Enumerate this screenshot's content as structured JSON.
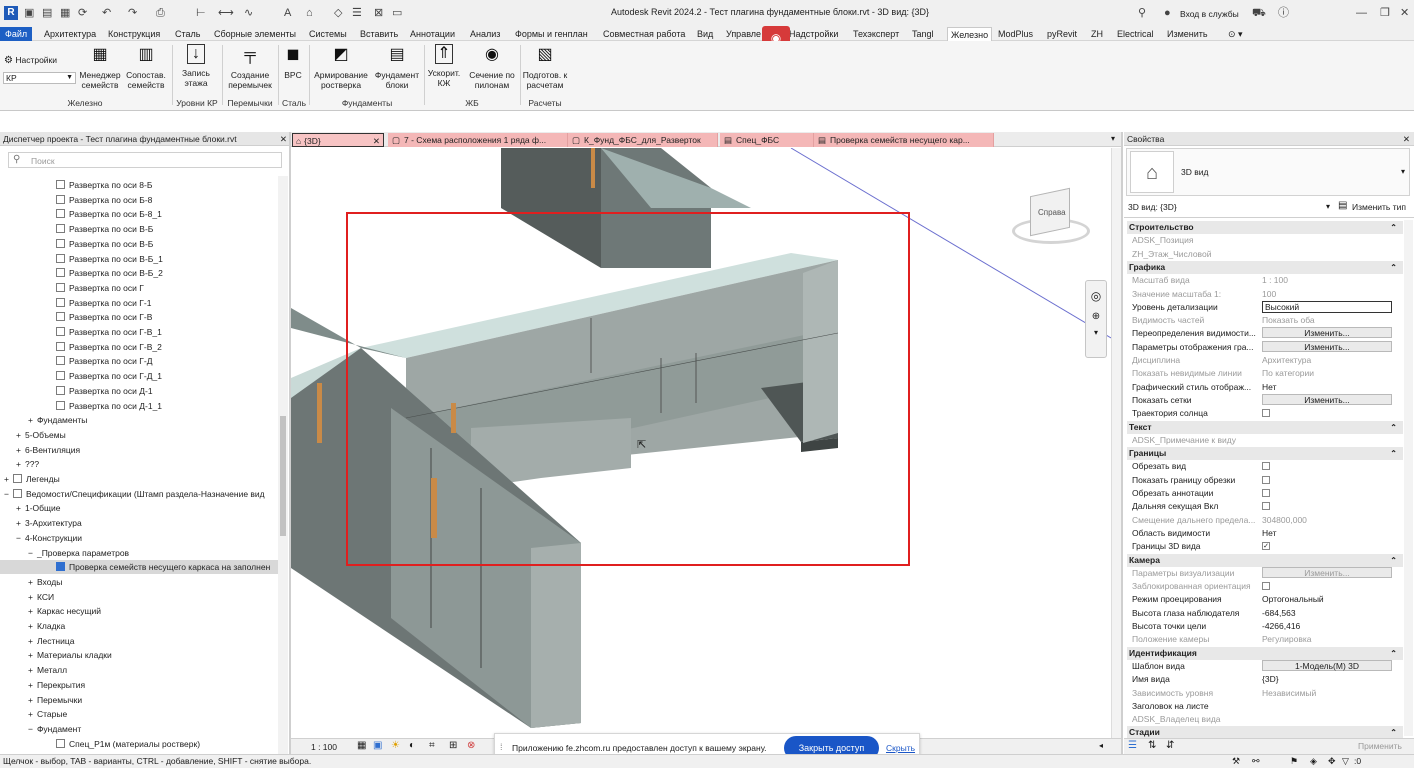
{
  "title_bar": {
    "title": "Autodesk Revit 2024.2 - Тест плагина фундаментные блоки.rvt - 3D вид: {3D}",
    "signin": "Вход в службы"
  },
  "menu": {
    "items": [
      "Файл",
      "Архитектура",
      "Конструкция",
      "Сталь",
      "Сборные элементы",
      "Системы",
      "Вставить",
      "Аннотации",
      "Анализ",
      "Формы и генплан",
      "Совместная работа",
      "Вид",
      "Управле",
      "Надстройки",
      "Техэксперт",
      "Tangl",
      "Железно",
      "ModPlus",
      "pyRevit",
      "ZH",
      "Electrical",
      "Изменить"
    ]
  },
  "ribbon": {
    "settings": "Настройки",
    "kr_select": "КР",
    "buttons": [
      {
        "label": "Менеджер семейств",
        "icon": "building-icon"
      },
      {
        "label": "Сопостав. семейств",
        "icon": "building-compare-icon"
      },
      {
        "label": "Запись этажа",
        "icon": "level-write-icon"
      },
      {
        "label": "Создание перемычек",
        "icon": "lintel-icon"
      },
      {
        "label": "BPC",
        "icon": "bps-icon"
      },
      {
        "label": "Армирование ростверка",
        "icon": "grillage-icon"
      },
      {
        "label": "Фундамент блоки",
        "icon": "blocks-icon"
      },
      {
        "label": "Ускорит. КЖ",
        "icon": "speed-icon"
      },
      {
        "label": "Сечение по пилонам",
        "icon": "eye-icon"
      },
      {
        "label": "Подготов. к расчетам",
        "icon": "calc-icon"
      }
    ],
    "groups": [
      "Железно",
      "Уровни КР",
      "Перемычки",
      "Сталь",
      "Фундаменты",
      "ЖБ",
      "Расчеты"
    ]
  },
  "project_browser": {
    "title": "Диспетчер проекта - Тест плагина фундаментные блоки.rvt",
    "search_placeholder": "Поиск",
    "items": [
      {
        "label": "Развертка по оси 8-Б",
        "level": 3,
        "box": true
      },
      {
        "label": "Развертка по оси Б-8",
        "level": 3,
        "box": true
      },
      {
        "label": "Развертка по оси Б-8_1",
        "level": 3,
        "box": true
      },
      {
        "label": "Развертка по оси В-Б",
        "level": 3,
        "box": true
      },
      {
        "label": "Развертка по оси В-Б",
        "level": 3,
        "box": true
      },
      {
        "label": "Развертка по оси В-Б_1",
        "level": 3,
        "box": true
      },
      {
        "label": "Развертка по оси В-Б_2",
        "level": 3,
        "box": true
      },
      {
        "label": "Развертка по оси Г",
        "level": 3,
        "box": true
      },
      {
        "label": "Развертка по оси Г-1",
        "level": 3,
        "box": true
      },
      {
        "label": "Развертка по оси Г-В",
        "level": 3,
        "box": true
      },
      {
        "label": "Развертка по оси Г-В_1",
        "level": 3,
        "box": true
      },
      {
        "label": "Развертка по оси Г-В_2",
        "level": 3,
        "box": true
      },
      {
        "label": "Развертка по оси Г-Д",
        "level": 3,
        "box": true
      },
      {
        "label": "Развертка по оси Г-Д_1",
        "level": 3,
        "box": true
      },
      {
        "label": "Развертка по оси Д-1",
        "level": 3,
        "box": true
      },
      {
        "label": "Развертка по оси Д-1_1",
        "level": 3,
        "box": true
      },
      {
        "label": "Фундаменты",
        "level": 2,
        "exp": "+"
      },
      {
        "label": "5-Объемы",
        "level": 1,
        "exp": "+"
      },
      {
        "label": "6-Вентиляция",
        "level": 1,
        "exp": "+"
      },
      {
        "label": "???",
        "level": 1,
        "exp": "+"
      },
      {
        "label": "Легенды",
        "level": 0,
        "exp": "+",
        "icon": true
      },
      {
        "label": "Ведомости/Спецификации (Штамп раздела-Назначение вид",
        "level": 0,
        "exp": "−",
        "icon": true
      },
      {
        "label": "1-Общие",
        "level": 1,
        "exp": "+"
      },
      {
        "label": "3-Архитектура",
        "level": 1,
        "exp": "+"
      },
      {
        "label": "4-Конструкции",
        "level": 1,
        "exp": "−"
      },
      {
        "label": "_Проверка параметров",
        "level": 2,
        "exp": "−"
      },
      {
        "label": "Проверка семейств несущего каркаса на заполнен",
        "level": 3,
        "box": true,
        "blue": true,
        "selected": true
      },
      {
        "label": "Входы",
        "level": 2,
        "exp": "+"
      },
      {
        "label": "КСИ",
        "level": 2,
        "exp": "+"
      },
      {
        "label": "Каркас несущий",
        "level": 2,
        "exp": "+"
      },
      {
        "label": "Кладка",
        "level": 2,
        "exp": "+"
      },
      {
        "label": "Лестница",
        "level": 2,
        "exp": "+"
      },
      {
        "label": "Материалы кладки",
        "level": 2,
        "exp": "+"
      },
      {
        "label": "Металл",
        "level": 2,
        "exp": "+"
      },
      {
        "label": "Перекрытия",
        "level": 2,
        "exp": "+"
      },
      {
        "label": "Перемычки",
        "level": 2,
        "exp": "+"
      },
      {
        "label": "Старые",
        "level": 2,
        "exp": "+"
      },
      {
        "label": "Фундамент",
        "level": 2,
        "exp": "−"
      },
      {
        "label": "Спец_Р1м (материалы ростверк)",
        "level": 3,
        "box": true
      }
    ]
  },
  "view_tabs": [
    "{3D}",
    "7 - Схема расположения 1 ряда ф...",
    "К_Фунд_ФБС_для_Разверток",
    "Спец_ФБС",
    "Проверка семейств несущего кар..."
  ],
  "viewcube_label": "Справа",
  "view_scale": "1 : 100",
  "notification": {
    "text": "Приложению fe.zhcom.ru предоставлен доступ к вашему экрану.",
    "close_button": "Закрыть доступ",
    "hide_link": "Скрыть"
  },
  "properties": {
    "header": "Свойства",
    "type_name": "3D вид",
    "view_selector": "3D вид: {3D}",
    "edit_type": "Изменить тип",
    "apply_button": "Применить",
    "rows": [
      {
        "cat": "Строительство"
      },
      {
        "name": "ADSK_Позиция",
        "gray": true
      },
      {
        "name": "ZH_Этаж_Числовой",
        "gray": true
      },
      {
        "cat": "Графика"
      },
      {
        "name": "Масштаб вида",
        "value": "1 : 100",
        "gray": true
      },
      {
        "name": "Значение масштаба   1:",
        "value": "100",
        "gray": true
      },
      {
        "name": "Уровень детализации",
        "value": "Высокий",
        "input": true
      },
      {
        "name": "Видимость частей",
        "value": "Показать оба",
        "gray": true
      },
      {
        "name": "Переопределения видимости...",
        "btn": "Изменить..."
      },
      {
        "name": "Параметры отображения гра...",
        "btn": "Изменить..."
      },
      {
        "name": "Дисциплина",
        "value": "Архитектура",
        "gray": true
      },
      {
        "name": "Показать невидимые линии",
        "value": "По категории",
        "gray": true
      },
      {
        "name": "Графический стиль отображ...",
        "value": "Нет"
      },
      {
        "name": "Показать сетки",
        "btn": "Изменить..."
      },
      {
        "name": "Траектория солнца",
        "check": false
      },
      {
        "cat": "Текст"
      },
      {
        "name": "ADSK_Примечание к виду",
        "gray": true
      },
      {
        "cat": "Границы"
      },
      {
        "name": "Обрезать вид",
        "check": false
      },
      {
        "name": "Показать границу обрезки",
        "check": false
      },
      {
        "name": "Обрезать аннотации",
        "check": false
      },
      {
        "name": "Дальняя секущая Вкл",
        "check": false
      },
      {
        "name": "Смещение дальнего предела...",
        "value": "304800,000",
        "gray": true
      },
      {
        "name": "Область видимости",
        "value": "Нет"
      },
      {
        "name": "Границы 3D вида",
        "check": true
      },
      {
        "cat": "Камера"
      },
      {
        "name": "Параметры визуализации",
        "btn": "Изменить...",
        "gray": true
      },
      {
        "name": "Заблокированная ориентация",
        "check": false,
        "gray": true
      },
      {
        "name": "Режим проецирования",
        "value": "Ортогональный"
      },
      {
        "name": "Высота глаза наблюдателя",
        "value": "-684,563"
      },
      {
        "name": "Высота точки цели",
        "value": "-4266,416"
      },
      {
        "name": "Положение камеры",
        "value": "Регулировка",
        "gray": true
      },
      {
        "cat": "Идентификация"
      },
      {
        "name": "Шаблон вида",
        "btn": "1-Модель(М) 3D"
      },
      {
        "name": "Имя вида",
        "value": "{3D}"
      },
      {
        "name": "Зависимость уровня",
        "value": "Независимый",
        "gray": true
      },
      {
        "name": "Заголовок на листе"
      },
      {
        "name": "ADSK_Владелец вида",
        "gray": true
      },
      {
        "cat": "Стадии"
      }
    ]
  },
  "status_bar": {
    "text": "Щелчок - выбор, TAB - варианты, CTRL - добавление, SHIFT - снятие выбора.",
    "filter_count": ":0"
  }
}
